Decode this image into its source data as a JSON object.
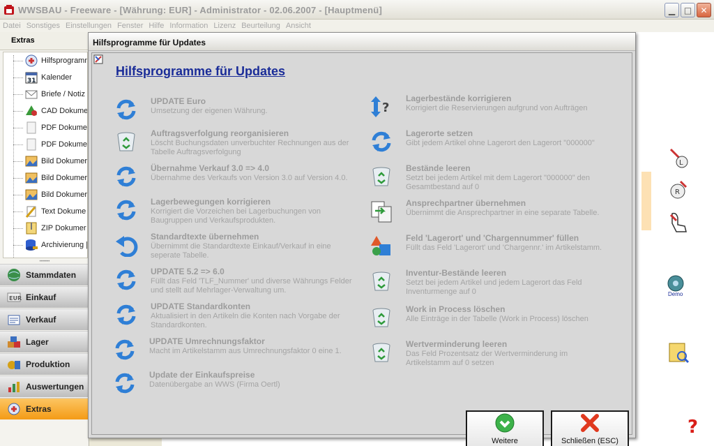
{
  "window": {
    "title": "WWSBAU - Freeware - [Währung: EUR] - Administrator - 02.06.2007 - [Hauptmenü]",
    "controls": [
      "minimize",
      "maximize",
      "close"
    ]
  },
  "menu": [
    "Datei",
    "Sonstiges",
    "Einstellungen",
    "Fenster",
    "Hilfe",
    "Information",
    "Lizenz",
    "Beurteilung",
    "Ansicht"
  ],
  "sidebar": {
    "header": "Extras",
    "tree": [
      {
        "label": "Hilfsprogramm",
        "icon": "tools-icon"
      },
      {
        "label": "Kalender",
        "icon": "calendar-icon"
      },
      {
        "label": "Briefe / Notiz",
        "icon": "letter-icon"
      },
      {
        "label": "CAD Dokume",
        "icon": "cad-icon"
      },
      {
        "label": "PDF Dokume",
        "icon": "pdf-icon"
      },
      {
        "label": "PDF Dokume",
        "icon": "pdf-icon"
      },
      {
        "label": "Bild Dokumer",
        "icon": "image-icon"
      },
      {
        "label": "Bild Dokumer",
        "icon": "image-icon"
      },
      {
        "label": "Bild Dokumer",
        "icon": "image-icon"
      },
      {
        "label": "Text Dokume",
        "icon": "text-icon"
      },
      {
        "label": "ZIP Dokumer",
        "icon": "zip-icon"
      },
      {
        "label": "Archivierung |",
        "icon": "database-icon"
      }
    ],
    "nav": [
      {
        "label": "Stammdaten",
        "icon": "globe-icon"
      },
      {
        "label": "Einkauf",
        "icon": "eur-icon"
      },
      {
        "label": "Verkauf",
        "icon": "notepad-icon"
      },
      {
        "label": "Lager",
        "icon": "boxes-icon"
      },
      {
        "label": "Produktion",
        "icon": "production-icon"
      },
      {
        "label": "Auswertungen",
        "icon": "chart-icon"
      },
      {
        "label": "Extras",
        "icon": "extras-icon",
        "active": true
      }
    ]
  },
  "dialog": {
    "title": "Hilfsprogramme für Updates",
    "heading": "Hilfsprogramme für Updates",
    "left_items": [
      {
        "title": "UPDATE Euro",
        "desc": "Umsetzung der eigenen Währung.",
        "icon": "refresh-icon"
      },
      {
        "title": "Auftragsverfolgung reorganisieren",
        "desc": "Löscht Buchungsdaten unverbuchter Rechnungen aus der Tabelle Auftragsverfolgung",
        "icon": "recycle-bin-icon"
      },
      {
        "title": "Übernahme Verkauf 3.0 => 4.0",
        "desc": "Übernahme des Verkaufs von Version 3.0 auf Version 4.0.",
        "icon": "refresh-icon"
      },
      {
        "title": "Lagerbewegungen korrigieren",
        "desc": "Korrigiert die Vorzeichen bei Lagerbuchungen von Baugruppen und Verkaufsprodukten.",
        "icon": "refresh-icon"
      },
      {
        "title": "Standardtexte übernehmen",
        "desc": "Übernimmt die Standardtexte Einkauf/Verkauf in eine seperate Tabelle.",
        "icon": "undo-icon"
      },
      {
        "title": "UPDATE 5.2 => 6.0",
        "desc": "Füllt das Feld 'TLF_Nummer' und diverse Währungs Felder und stellt auf Mehrlager-Verwaltung um.",
        "icon": "refresh-icon"
      },
      {
        "title": "UPDATE Standardkonten",
        "desc": "Aktualisiert in den Artikeln die Konten nach Vorgabe der Standardkonten.",
        "icon": "refresh-icon"
      },
      {
        "title": "UPDATE Umrechnungsfaktor",
        "desc": "Macht im Artikelstamm aus Umrechnungsfaktor 0 eine 1.",
        "icon": "refresh-icon"
      },
      {
        "title": "Update der Einkaufspreise",
        "desc": "Datenübergabe an WWS (Firma Oertl)",
        "icon": "refresh-icon"
      }
    ],
    "right_items": [
      {
        "title": "Lagerbestände korrigieren",
        "desc": "Korrigiert die Reservierungen aufgrund von Aufträgen",
        "icon": "updown-question-icon"
      },
      {
        "title": "Lagerorte setzen",
        "desc": "Gibt jedem Artikel ohne Lagerort den Lagerort \"000000\"",
        "icon": "refresh-icon"
      },
      {
        "title": "Bestände leeren",
        "desc": "Setzt bei jedem Artikel mit dem Lagerort \"000000\" den Gesamtbestand auf 0",
        "icon": "recycle-bin-icon"
      },
      {
        "title": "Ansprechpartner übernehmen",
        "desc": "Übernimmt die Ansprechpartner in eine separate Tabelle.",
        "icon": "transfer-icon"
      },
      {
        "title": "Feld 'Lagerort' und 'Chargennummer' füllen",
        "desc": "Füllt das Feld 'Lagerort' und 'Chargennr.' im Artikelstamm.",
        "icon": "shapes-icon"
      },
      {
        "title": "Inventur-Bestände leeren",
        "desc": "Setzt bei jedem Artikel und jedem Lagerort das Feld Inventurmenge auf 0",
        "icon": "recycle-bin-icon"
      },
      {
        "title": "Work in Process löschen",
        "desc": "Alle Einträge in der Tabelle (Work in Process) löschen",
        "icon": "recycle-bin-icon"
      },
      {
        "title": "Wertverminderung leeren",
        "desc": "Das Feld Prozentsatz der Wertverminderung im Artikelstamm auf 0 setzen",
        "icon": "recycle-bin-icon"
      }
    ],
    "buttons": {
      "next": "Weitere",
      "close": "Schließen (ESC)"
    }
  },
  "background": {
    "demo_label": "Demo",
    "help": "?"
  },
  "colors": {
    "heading": "#1a2c98",
    "active_nav": "#f49b16",
    "disabled_text": "#9c9c9c"
  }
}
